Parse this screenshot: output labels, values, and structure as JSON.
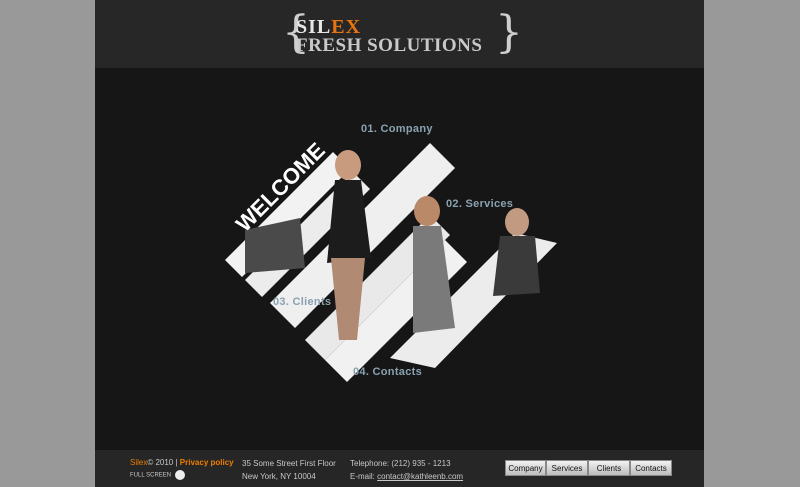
{
  "logo": {
    "brace_left": "{",
    "brace_right": "}",
    "name_part1": "SIL",
    "name_part2": "EX",
    "tagline": "FRESH SOLUTIONS"
  },
  "hero": {
    "welcome": "WELCOME"
  },
  "menu": [
    {
      "label": "01. Company"
    },
    {
      "label": "02. Services"
    },
    {
      "label": "03. Clients"
    },
    {
      "label": "04. Contacts"
    }
  ],
  "footer": {
    "brand": "Silex",
    "copyright": "© 2010 |",
    "privacy": "Privacy policy",
    "fullscreen": "FULL SCREEN",
    "address_line1": "35 Some Street First Floor",
    "address_line2": "New York, NY 10004",
    "telephone": "Telephone: (212) 935 - 1213",
    "email_label": "E-mail:",
    "email": "contact@kathleenb.com",
    "buttons": [
      "Company",
      "Services",
      "Clients",
      "Contacts"
    ]
  },
  "colors": {
    "accent": "#f07d00",
    "menu_link": "#8aa2b0",
    "background": "#161616"
  }
}
